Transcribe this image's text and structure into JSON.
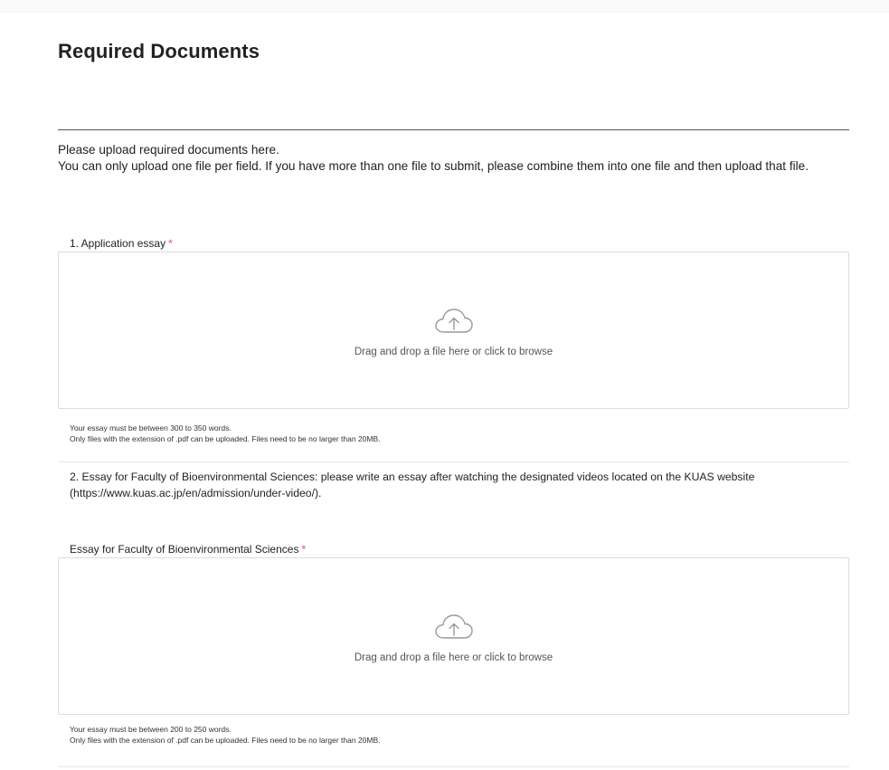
{
  "page": {
    "title": "Required Documents",
    "intro_line1": "Please upload required documents here.",
    "intro_line2": "You can only upload one file per field. If you have more than one file to submit, please combine them into one file and then upload that file."
  },
  "fields": [
    {
      "label": "1. Application essay",
      "required_mark": "*",
      "dropzone_text": "Drag and drop a file here or click to browse",
      "help_line1": "Your essay must be between 300 to 350 words.",
      "help_line2": "Only files with the extension of .pdf can be uploaded. Files need to be no larger than 20MB."
    },
    {
      "description": "2. Essay for Faculty of Bioenvironmental Sciences: please write an essay after watching the designated videos located on the KUAS website (https://www.kuas.ac.jp/en/admission/under-video/).",
      "label": "Essay for Faculty of Bioenvironmental Sciences",
      "required_mark": "*",
      "dropzone_text": "Drag and drop a file here or click to browse",
      "help_line1": "Your essay must be between 200 to 250 words.",
      "help_line2": "Only files with the extension of .pdf can be uploaded. Files need to be no larger than 20MB."
    }
  ],
  "icons": {
    "upload": "cloud-upload-icon"
  },
  "colors": {
    "required": "#d9534f",
    "border": "#dcdcdc",
    "divider": "#555555"
  }
}
